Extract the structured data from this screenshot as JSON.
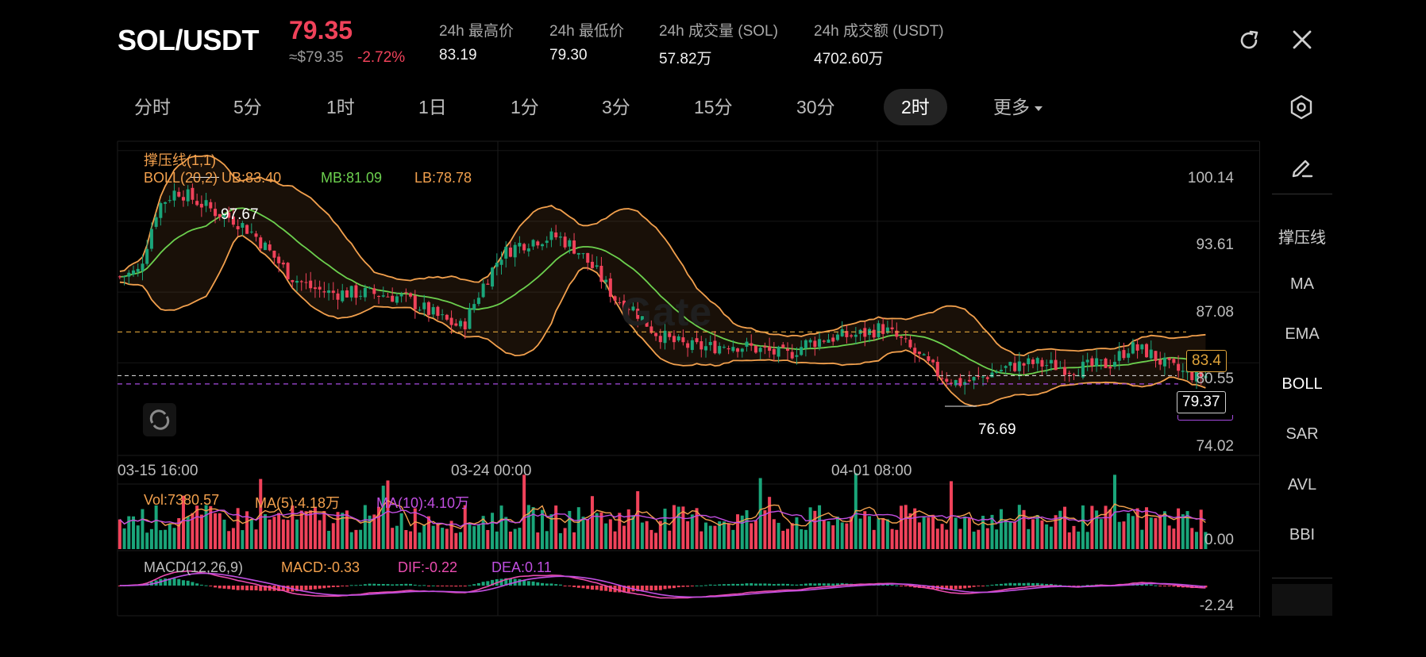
{
  "header": {
    "pair": "SOL/USDT",
    "price": "79.35",
    "price_usd": "≈$79.35",
    "change": "-2.72%",
    "stats": [
      {
        "label": "24h 最高价",
        "value": "83.19"
      },
      {
        "label": "24h 最低价",
        "value": "79.30"
      },
      {
        "label": "24h 成交量 (SOL)",
        "value": "57.82万"
      },
      {
        "label": "24h 成交额 (USDT)",
        "value": "4702.60万"
      }
    ],
    "icons": [
      "refresh-icon",
      "close-icon"
    ]
  },
  "timeframes": [
    "分时",
    "5分",
    "1时",
    "1日",
    "1分",
    "3分",
    "15分",
    "30分",
    "2时",
    "更多"
  ],
  "active_timeframe": "2时",
  "sidebar": {
    "tools": [
      "pencil-icon"
    ],
    "indicators": [
      "撑压线",
      "MA",
      "EMA",
      "BOLL",
      "SAR",
      "AVL",
      "BBI"
    ],
    "active_indicator": "BOLL"
  },
  "main_chart": {
    "sr_label": "撑压线(1,1)",
    "boll_label": "BOLL(20,2) UB:83.40",
    "mb_label": "MB:81.09",
    "lb_label": "LB:78.78",
    "y_ticks": [
      "100.14",
      "93.61",
      "87.08",
      "80.55",
      "74.02"
    ],
    "x_ticks": [
      "03-15 16:00",
      "03-24 00:00",
      "04-01 08:00"
    ],
    "high_marker": "97.67",
    "low_marker": "76.69",
    "resistance_tag": "83.4",
    "last_price_tag": "79.37",
    "watermark": "Gate"
  },
  "volume_chart": {
    "vol_label": "Vol:7380.57",
    "ma5_label": "MA(5):4.18万",
    "ma10_label": "MA(10):4.10万",
    "y_tick": "0.00"
  },
  "macd_chart": {
    "macd_label": "MACD(12,26,9)",
    "macd_value": "MACD:-0.33",
    "dif_label": "DIF:-0.22",
    "dea_label": "DEA:0.11",
    "y_tick": "-2.24"
  },
  "colors": {
    "up": "#1aa57a",
    "down": "#f0425a",
    "ub": "#f2a04d",
    "mb": "#6cd04e",
    "lb": "#f2a04d",
    "ma10": "#c04ee0",
    "dif": "#e94caf",
    "dea": "#c04ee0",
    "resistance": "#e0a43a",
    "support": "#a64be0"
  },
  "chart_data": {
    "type": "candlestick",
    "timeframe": "2时",
    "y_range": [
      72,
      101
    ],
    "x_ticks": [
      "03-15 16:00",
      "03-24 00:00",
      "04-01 08:00"
    ],
    "close_series_approx": [
      88.5,
      89.0,
      95.0,
      96.5,
      95.5,
      94.5,
      93.8,
      92.5,
      90.5,
      88.5,
      87.5,
      87.0,
      87.0,
      87.0,
      86.8,
      86.5,
      85.5,
      84.5,
      83.8,
      87.5,
      90.5,
      91.5,
      92.0,
      92.2,
      91.0,
      89.0,
      86.5,
      85.5,
      83.5,
      82.5,
      82.0,
      82.0,
      82.3,
      82.0,
      81.6,
      81.2,
      82.3,
      82.8,
      83.0,
      83.2,
      83.8,
      82.6,
      81.0,
      79.5,
      78.7,
      79.0,
      79.8,
      80.3,
      80.5,
      80.3,
      80.0,
      80.2,
      80.5,
      82.0,
      81.5,
      80.2,
      79.5,
      79.37
    ],
    "boll_ub": 83.4,
    "boll_mb": 81.09,
    "boll_lb": 78.78,
    "marked_high": 97.67,
    "marked_low": 76.69,
    "resistance": 83.4,
    "last": 79.37
  }
}
